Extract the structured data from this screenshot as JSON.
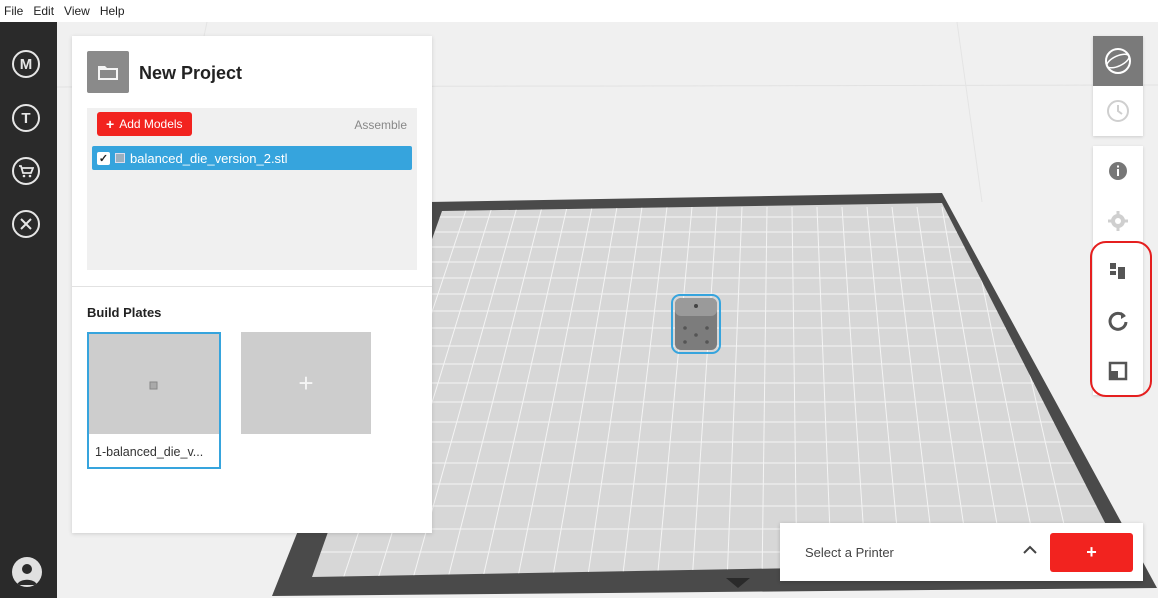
{
  "menu": [
    "File",
    "Edit",
    "View",
    "Help"
  ],
  "rail": {
    "items": [
      {
        "name": "makerbot-logo-icon",
        "glyph": "M"
      },
      {
        "name": "thingiverse-icon",
        "glyph": "T"
      },
      {
        "name": "store-cart-icon",
        "glyph": "🛒"
      },
      {
        "name": "utilities-tools-icon",
        "glyph": "⚒"
      }
    ],
    "account": "account-avatar"
  },
  "project": {
    "title": "New Project",
    "add_models_label": "Add Models",
    "add_models_icon": "+",
    "assemble_label": "Assemble",
    "model_file": "balanced_die_version_2.stl",
    "model_checked": "✓"
  },
  "build_plates": {
    "title": "Build Plates",
    "plate_label": "1-balanced_die_v...",
    "add_plate": "+"
  },
  "printer": {
    "select_label": "Select a Printer",
    "chevron": "^",
    "add": "+"
  },
  "colors": {
    "accent_red": "#f2231f",
    "selection_blue": "#36a4dd",
    "rail_dark": "#2a2a2a"
  }
}
